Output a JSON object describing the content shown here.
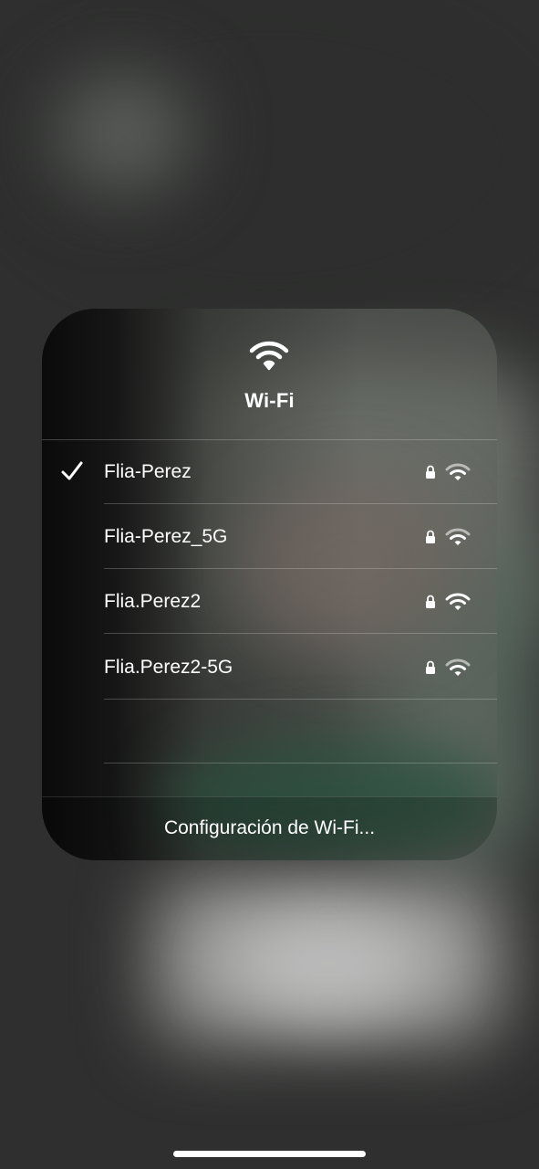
{
  "panel": {
    "title": "Wi-Fi",
    "header_icon": "wifi-icon",
    "networks": [
      {
        "name": "Flia-Perez",
        "connected": true,
        "secured": true,
        "signal": "full-dimmed"
      },
      {
        "name": "Flia-Perez_5G",
        "connected": false,
        "secured": true,
        "signal": "full-dimmed"
      },
      {
        "name": "Flia.Perez2",
        "connected": false,
        "secured": true,
        "signal": "full"
      },
      {
        "name": "Flia.Perez2-5G",
        "connected": false,
        "secured": true,
        "signal": "full-dimmed"
      }
    ],
    "settings_label": "Configuración de Wi-Fi..."
  },
  "colors": {
    "text": "#ffffff",
    "background": "#2e2f2e",
    "accent_green": "#2f5a45"
  }
}
